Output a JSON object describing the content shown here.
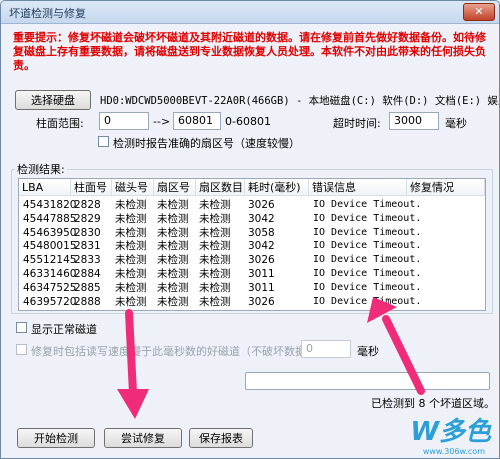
{
  "window": {
    "title": "坏道检测与修复",
    "close_label": "✕"
  },
  "warning": {
    "text": "重要提示：修复坏磁道会破坏坏磁道及其附近磁道的数据。请在修复前首先做好数据备份。如待修复磁盘上存有重要数据，请将磁盘送到专业数据恢复人员处理。本软件不对由此带来的任何损失负责。"
  },
  "disk": {
    "select_label": "选择硬盘",
    "info": "HD0:WDCWD5000BEVT-22A0R(466GB) - 本地磁盘(C:) 软件(D:) 文档(E:) 娱乐"
  },
  "range": {
    "label": "柱面范围:",
    "from": "0",
    "arrow": "-->",
    "to": "60801",
    "span": "0-60801",
    "timeout_label": "超时时间:",
    "timeout_value": "3000",
    "timeout_unit": "毫秒"
  },
  "option_accurate": {
    "label": "检测时报告准确的扇区号（速度较慢）",
    "checked": false
  },
  "results": {
    "group_label": "检测结果:",
    "columns": [
      "LBA",
      "柱面号",
      "磁头号",
      "扇区号",
      "扇区数目",
      "耗时(毫秒)",
      "错误信息",
      "修复情况"
    ],
    "rows": [
      [
        "45431820",
        "2828",
        "未检测",
        "未检测",
        "未检测",
        "3026",
        "IO Device Timeout.",
        ""
      ],
      [
        "45447885",
        "2829",
        "未检测",
        "未检测",
        "未检测",
        "3042",
        "IO Device Timeout.",
        ""
      ],
      [
        "45463950",
        "2830",
        "未检测",
        "未检测",
        "未检测",
        "3058",
        "IO Device Timeout.",
        ""
      ],
      [
        "45480015",
        "2831",
        "未检测",
        "未检测",
        "未检测",
        "3042",
        "IO Device Timeout.",
        ""
      ],
      [
        "45512145",
        "2833",
        "未检测",
        "未检测",
        "未检测",
        "3026",
        "IO Device Timeout.",
        ""
      ],
      [
        "46331460",
        "2884",
        "未检测",
        "未检测",
        "未检测",
        "3011",
        "IO Device Timeout.",
        ""
      ],
      [
        "46347525",
        "2885",
        "未检测",
        "未检测",
        "未检测",
        "3011",
        "IO Device Timeout.",
        ""
      ],
      [
        "46395720",
        "2888",
        "未检测",
        "未检测",
        "未检测",
        "3026",
        "IO Device Timeout.",
        ""
      ]
    ]
  },
  "option_normal": {
    "label": "显示正常磁道",
    "checked": false
  },
  "option_repair": {
    "label": "修复时包括读写速度慢于此毫秒数的好磁道（不破坏数据）:",
    "value": "0",
    "unit": "毫秒"
  },
  "progress": {
    "fraction": 0.0
  },
  "status": {
    "text": "已检测到 8 个坏道区域。"
  },
  "buttons": {
    "start": "开始检测",
    "repair": "尝试修复",
    "save": "保存报表"
  },
  "watermark": {
    "text": "W多色",
    "url": "www.306w.com"
  },
  "colors": {
    "warning": "#e00000",
    "arrow": "#f02c78"
  }
}
